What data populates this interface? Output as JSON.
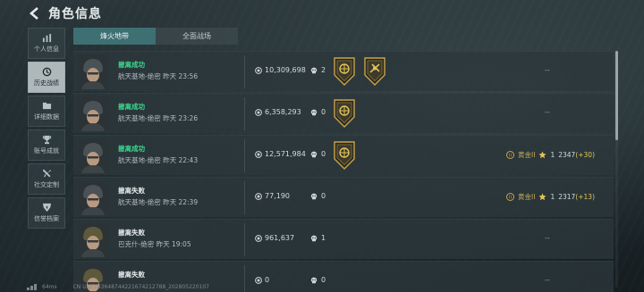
{
  "header": {
    "title": "角色信息"
  },
  "sidebar": {
    "items": [
      {
        "label": "个人信息",
        "icon": "bar-chart-icon"
      },
      {
        "label": "历史战绩",
        "icon": "history-clock-icon",
        "active": true
      },
      {
        "label": "详细数据",
        "icon": "folder-icon"
      },
      {
        "label": "账号成就",
        "icon": "trophy-icon"
      },
      {
        "label": "社交定制",
        "icon": "tools-icon"
      },
      {
        "label": "信誉档案",
        "icon": "shield-badge-icon"
      }
    ]
  },
  "tabs": [
    {
      "label": "烽火地带",
      "active": true
    },
    {
      "label": "全面战场",
      "active": false
    }
  ],
  "records": [
    {
      "result": "撤离成功",
      "success": true,
      "place": "航天基地-绝密 昨天 23:56",
      "value": "10,309,698",
      "kills": "2",
      "medals": 2,
      "rank": null
    },
    {
      "result": "撤离成功",
      "success": true,
      "place": "航天基地-绝密 昨天 23:26",
      "value": "6,358,293",
      "kills": "0",
      "medals": 1,
      "rank": null
    },
    {
      "result": "撤离成功",
      "success": true,
      "place": "航天基地-绝密 昨天 22:43",
      "value": "12,571,984",
      "kills": "0",
      "medals": 1,
      "rank": {
        "tier": "黄金II",
        "stars": "1",
        "score": "2347",
        "delta": "(+30)"
      }
    },
    {
      "result": "撤离失败",
      "success": false,
      "place": "航天基地-绝密 昨天 22:39",
      "value": "77,190",
      "kills": "0",
      "medals": 0,
      "rank": {
        "tier": "黄金II",
        "stars": "1",
        "score": "2317",
        "delta": "(+13)"
      }
    },
    {
      "result": "撤离失败",
      "success": false,
      "place": "巴克什-绝密 昨天 19:05",
      "value": "961,637",
      "kills": "1",
      "medals": 0,
      "rank": null
    },
    {
      "result": "撤离失败",
      "success": false,
      "place": "",
      "value": "0",
      "kills": "0",
      "medals": 0,
      "rank": null
    }
  ],
  "empty_rank": "--",
  "footer": {
    "ping": "64ms",
    "uid": "CN UID:183648744221674212788_202805220107"
  },
  "colors": {
    "accent_tab": "#3d6f73",
    "success": "#39d98f",
    "gold": "#c9a24a"
  }
}
